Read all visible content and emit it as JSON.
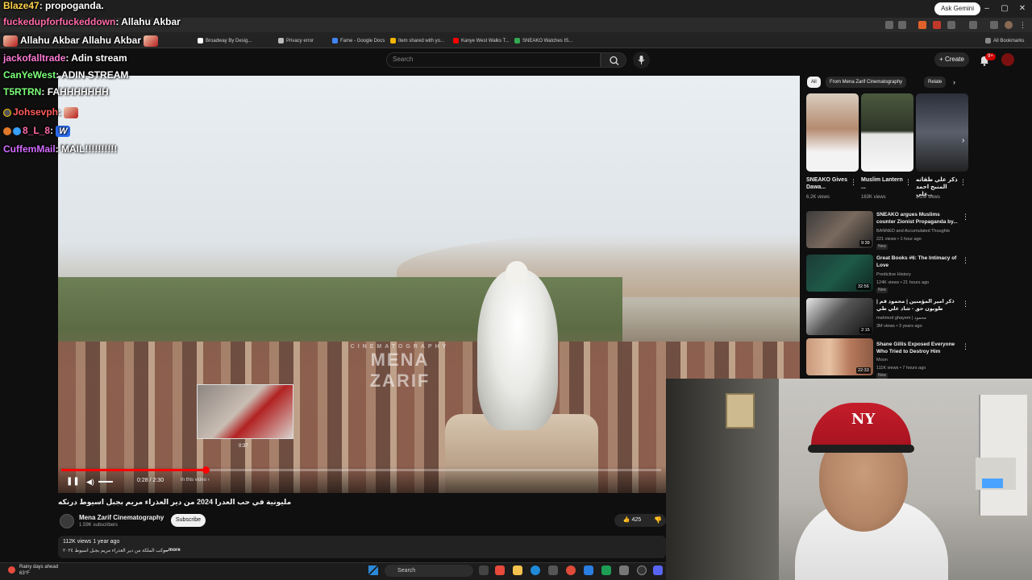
{
  "browser": {
    "ask_gemini": "Ask Gemini",
    "window_controls": [
      "–",
      "▢",
      "✕"
    ],
    "bookmarks": [
      {
        "label": "Broadway By Desig...",
        "color": "#ffffff"
      },
      {
        "label": "Privacy error",
        "color": "#e8eaed"
      },
      {
        "label": "Fame - Google Docs",
        "color": "#4285f4"
      },
      {
        "label": "Item shared with yo...",
        "color": "#f4b400"
      },
      {
        "label": "Kanye West Walks T...",
        "color": "#ff0000"
      },
      {
        "label": "SNEAKO Watches IS...",
        "color": "#34a853"
      }
    ],
    "all_bookmarks": "All Bookmarks"
  },
  "youtube": {
    "search_placeholder": "Search",
    "create_label": "Create",
    "notif_count": "9+",
    "player": {
      "watermark": "MENA ZARIF",
      "watermark_sub": "CINEMATOGRAPHY",
      "time": "0:28 / 2:30",
      "chapter": "In this video ›",
      "preview_time": "0:37",
      "progress": 0.24
    },
    "video_title": "مليونية في حب العدرا 2024 من دير العذراء مريم بجبل اسيوط درنكه",
    "channel": {
      "name": "Mena Zarif Cinematography",
      "subs": "1.59K subscribers",
      "subscribe_label": "Subscribe"
    },
    "likes": "425",
    "description": {
      "stats": "112K views  1 year ago",
      "text": "موكب الملكة من دير العذراء مريم بجبل اسيوط ٢٠٢٤",
      "more": "...more"
    },
    "chips": [
      "All",
      "From Mena Zarif Cinematography",
      "Relate"
    ],
    "shorts": [
      {
        "title": "SNEAKO Gives Dawa...",
        "views": "6.2K views"
      },
      {
        "title": "Muslim Lantern ...",
        "views": "163K views"
      },
      {
        "title": "ذكر علي طقاته المنبج احمد علي...",
        "views": "2.2M views"
      }
    ],
    "recommended": [
      {
        "title": "SNEAKO argues Muslims counter Zionist Propaganda by...",
        "channel": "BANNED and Accumulated Thoughts",
        "meta": "221 views • 1 hour ago",
        "badge": "New",
        "duration": "9:39"
      },
      {
        "title": "Great Books #6: The Intimacy of Love",
        "channel": "Predictive History",
        "meta": "124K views • 21 hours ago",
        "badge": "New",
        "duration": "32:56"
      },
      {
        "title": "ذكر امير المؤمنين | محمود قم | طوبون حق - شاد علي طي",
        "channel": "mahmod ghayem | محمود",
        "meta": "3M views • 3 years ago",
        "badge": "",
        "duration": "2:15"
      },
      {
        "title": "Shane Gillis Exposed Everyone Who Tried to Destroy Him",
        "channel": "Moon",
        "meta": "111K views • 7 hours ago",
        "badge": "New",
        "duration": "22:33"
      }
    ]
  },
  "chat": [
    {
      "user": "Blaze47",
      "msg": "propoganda.",
      "color": "#ffd24a",
      "emote": false
    },
    {
      "user": "fuckedupforfuckeddown",
      "msg": "Allahu Akbar",
      "color": "#ff6aa9",
      "emote": false
    },
    {
      "user": "",
      "msg": "Allahu Akbar  Allahu Akbar",
      "color": "#ffffff",
      "emote": true
    },
    {
      "user": "jackofalltrade",
      "msg": "Adin stream",
      "color": "#ff7bd6",
      "emote": false
    },
    {
      "user": "CanYeWest",
      "msg": "ADIN STREAM",
      "color": "#7dff7a",
      "emote": false
    },
    {
      "user": "T5RTRN",
      "msg": "FAHHHHHHH",
      "color": "#7dff7a",
      "emote": false
    },
    {
      "user": "Johsevph",
      "msg": "",
      "color": "#ff5a5a",
      "emote": true
    },
    {
      "user": "8_L_8",
      "msg": "",
      "color": "#ff6aa9",
      "emote": true
    },
    {
      "user": "CuffemMail",
      "msg": "MAIL!!!!!!!!!!",
      "color": "#d26bff",
      "emote": false
    }
  ],
  "taskbar": {
    "weather_title": "Rainy days ahead",
    "weather_temp": "63°F",
    "search": "Search"
  }
}
